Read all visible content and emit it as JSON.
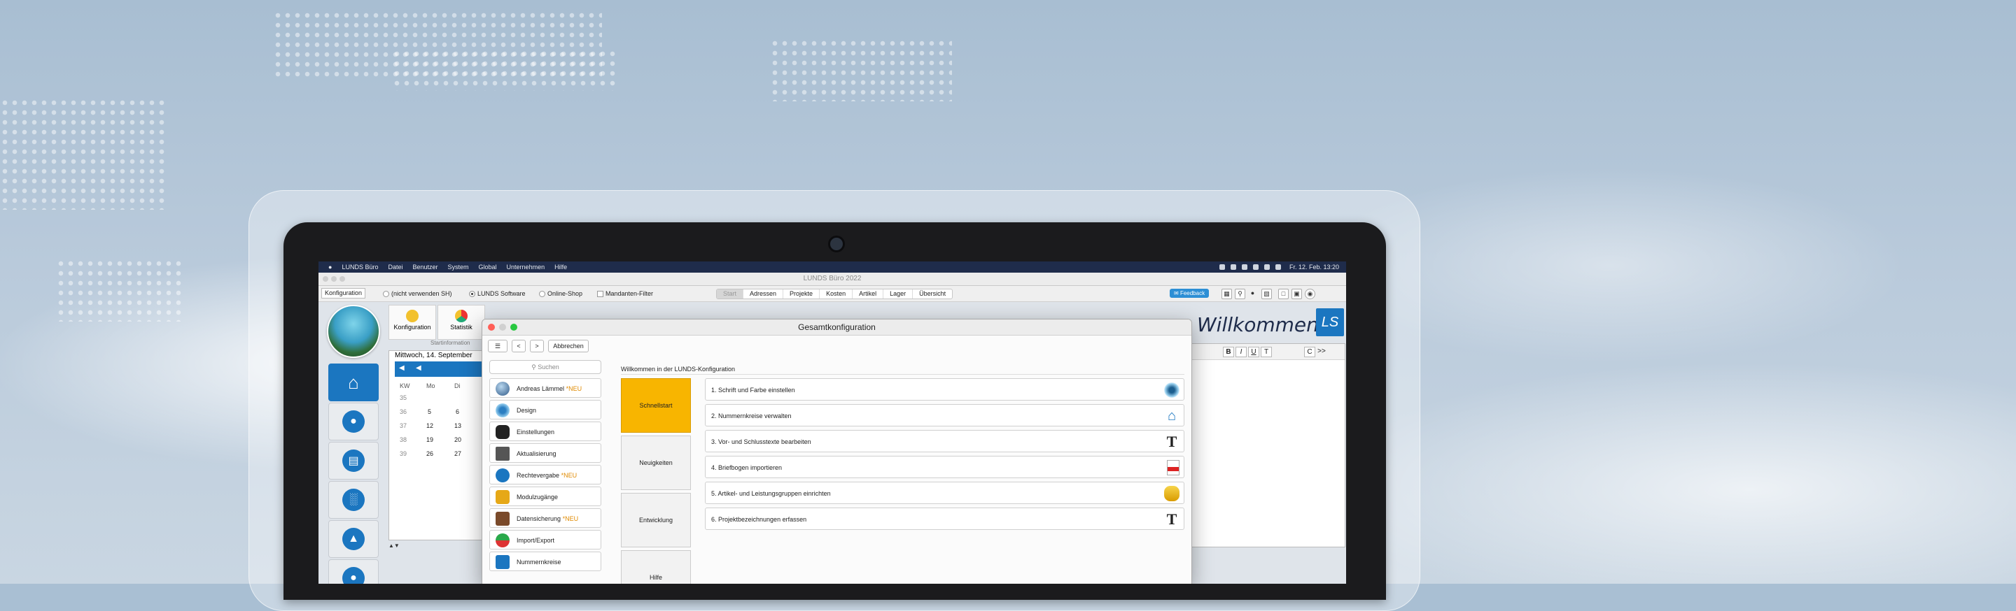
{
  "menubar": {
    "apple": "",
    "items": [
      "LUNDS Büro",
      "Datei",
      "Benutzer",
      "System",
      "Global",
      "Unternehmen",
      "Hilfe"
    ],
    "clock": "Fr. 12. Feb. 13:20"
  },
  "window": {
    "title": "LUNDS Büro 2022"
  },
  "toolbar": {
    "konfiguration": "Konfiguration",
    "filter1": "(nicht verwenden SH)",
    "filter2": "LUNDS Software",
    "filter3": "Online-Shop",
    "filter4": "Mandanten-Filter",
    "segments": [
      "Start",
      "Adressen",
      "Projekte",
      "Kosten",
      "Artikel",
      "Lager",
      "Übersicht"
    ],
    "feedback": "Feedback"
  },
  "mid": {
    "tab1": "Konfiguration",
    "tab2": "Statistik",
    "sub": "Startinformation",
    "date": "Mittwoch, 14. September",
    "cal_headers": [
      "KW",
      "Mo",
      "Di"
    ],
    "cal_rows": [
      [
        "35",
        "",
        ""
      ],
      [
        "36",
        "5",
        "6"
      ],
      [
        "37",
        "12",
        "13"
      ],
      [
        "38",
        "19",
        "20"
      ],
      [
        "39",
        "26",
        "27"
      ]
    ]
  },
  "right": {
    "welcome": "Willkommen",
    "logo": "LS",
    "editor_tools": [
      "B",
      "I",
      "U",
      "T",
      "C",
      ">>"
    ]
  },
  "modal": {
    "title": "Gesamtkonfiguration",
    "back": "<",
    "forward": ">",
    "cancel": "Abbrechen",
    "search_placeholder": "Suchen",
    "nav": [
      {
        "label": "Andreas Lämmel",
        "tag": "*NEU"
      },
      {
        "label": "Design",
        "tag": ""
      },
      {
        "label": "Einstellungen",
        "tag": ""
      },
      {
        "label": "Aktualisierung",
        "tag": ""
      },
      {
        "label": "Rechtevergabe",
        "tag": "*NEU"
      },
      {
        "label": "Modulzugänge",
        "tag": ""
      },
      {
        "label": "Datensicherung",
        "tag": "*NEU"
      },
      {
        "label": "Import/Export",
        "tag": ""
      },
      {
        "label": "Nummernkreise",
        "tag": ""
      }
    ],
    "heading": "Willkommen in der LUNDS-Konfiguration",
    "sections": [
      "Schnellstart",
      "Neuigkeiten",
      "Entwicklung",
      "Hilfe"
    ],
    "tasks": [
      {
        "label": "1. Schrift und Farbe einstellen",
        "icon": "eye-icon"
      },
      {
        "label": "2. Nummernkreise verwalten",
        "icon": "house-icon"
      },
      {
        "label": "3. Vor- und Schlusstexte bearbeiten",
        "icon": "text-icon"
      },
      {
        "label": "4. Briefbogen importieren",
        "icon": "pdf-icon"
      },
      {
        "label": "5. Artikel- und Leistungsgruppen einrichten",
        "icon": "coins-icon"
      },
      {
        "label": "6. Projektbezeichnungen erfassen",
        "icon": "text-icon"
      }
    ]
  },
  "colors": {
    "accent": "#1b76c0",
    "highlight": "#f8b500",
    "menubar": "#1f2c4b"
  }
}
